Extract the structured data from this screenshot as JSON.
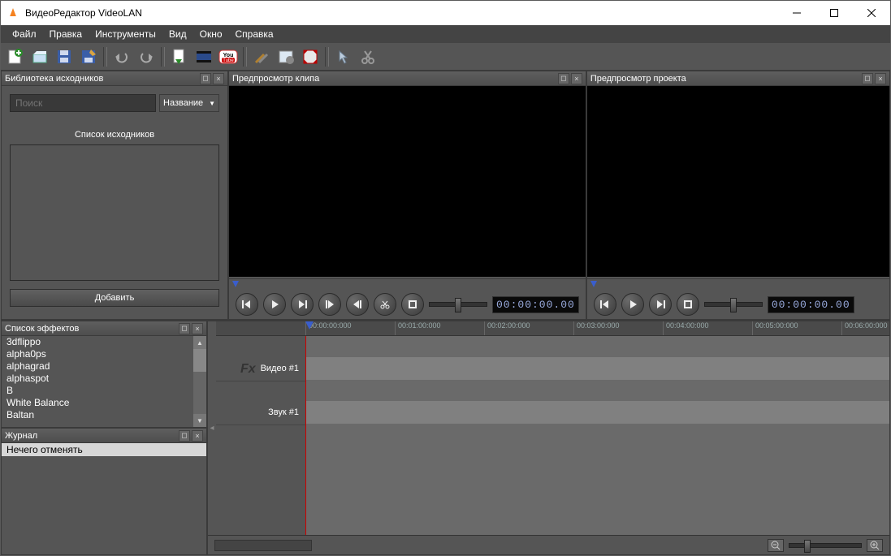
{
  "window": {
    "title": "ВидеоРедактор VideoLAN"
  },
  "menu": [
    "Файл",
    "Правка",
    "Инструменты",
    "Вид",
    "Окно",
    "Справка"
  ],
  "panels": {
    "library": {
      "title": "Библиотека исходников",
      "search_placeholder": "Поиск",
      "sort_label": "Название",
      "list_title": "Список исходников",
      "add_button": "Добавить"
    },
    "clip_preview": {
      "title": "Предпросмотр клипа",
      "timecode": "00:00:00.00"
    },
    "project_preview": {
      "title": "Предпросмотр проекта",
      "timecode": "00:00:00.00"
    },
    "effects": {
      "title": "Список эффектов",
      "items": [
        "3dflippo",
        "alpha0ps",
        "alphagrad",
        "alphaspot",
        "B",
        "White Balance",
        "Baltan"
      ]
    },
    "journal": {
      "title": "Журнал",
      "rows": [
        "Нечего отменять"
      ]
    }
  },
  "timeline": {
    "ruler": [
      "00:00:00:000",
      "00:01:00:000",
      "00:02:00:000",
      "00:03:00:000",
      "00:04:00:000",
      "00:05:00:000",
      "00:06:00:000"
    ],
    "tracks": {
      "video": "Видео #1",
      "audio": "Звук #1",
      "fx_label": "Fx"
    }
  }
}
